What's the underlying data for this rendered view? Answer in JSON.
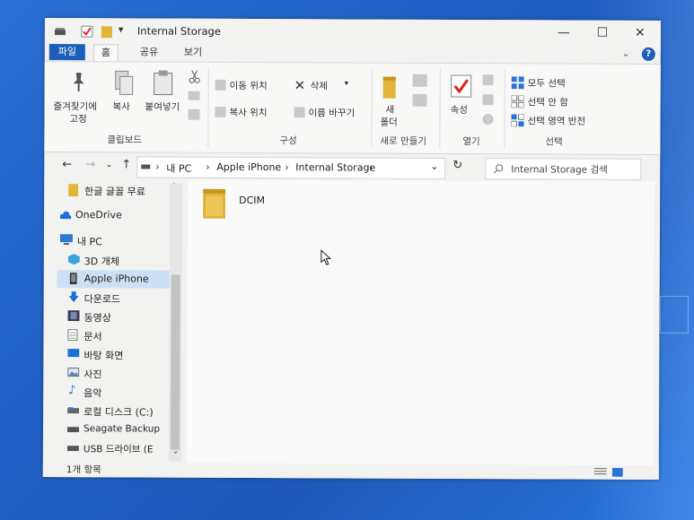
{
  "window": {
    "title": "Internal Storage",
    "minimize_glyph": "—",
    "maximize_glyph": "☐",
    "close_glyph": "✕",
    "dropdown_glyph": "▾"
  },
  "ribbon_tabs": [
    "파일",
    "홈",
    "공유",
    "보기"
  ],
  "ribbon": {
    "clipboard": {
      "pin_label_line1": "즐겨찾기에",
      "pin_label_line2": "고정",
      "copy_label": "복사",
      "paste_label": "붙여넣기",
      "group_label": "클립보드"
    },
    "organize": {
      "move_to": "이동 위치",
      "copy_to": "복사 위치",
      "delete": "삭제",
      "rename": "이름 바꾸기",
      "group_label": "구성"
    },
    "new": {
      "new_folder_line1": "새",
      "new_folder_line2": "폴더",
      "group_label": "새로 만들기"
    },
    "open": {
      "properties": "속성",
      "group_label": "열기"
    },
    "select": {
      "select_all": "모두 선택",
      "select_none": "선택 안 함",
      "invert_selection": "선택 영역 반전",
      "group_label": "선택"
    },
    "help_glyph": "?"
  },
  "address_bar": {
    "segments": [
      "내 PC",
      "Apple iPhone",
      "Internal Storage"
    ],
    "separator": "›",
    "search_placeholder": "Internal Storage 검색"
  },
  "sidebar": {
    "items": [
      {
        "label": "한글 글꼴 무료",
        "icon": "folder-icon"
      },
      {
        "label": "OneDrive",
        "icon": "cloud-icon"
      },
      {
        "label": "내 PC",
        "icon": "pc-icon"
      },
      {
        "label": "3D 개체",
        "icon": "cube-icon"
      },
      {
        "label": "Apple iPhone",
        "icon": "phone-icon"
      },
      {
        "label": "다운로드",
        "icon": "download-icon"
      },
      {
        "label": "동영상",
        "icon": "video-icon"
      },
      {
        "label": "문서",
        "icon": "document-icon"
      },
      {
        "label": "바탕 화면",
        "icon": "desktop-icon"
      },
      {
        "label": "사진",
        "icon": "picture-icon"
      },
      {
        "label": "음악",
        "icon": "music-icon"
      },
      {
        "label": "로컬 디스크 (C:)",
        "icon": "drive-icon"
      },
      {
        "label": "Seagate Backup",
        "icon": "drive-icon"
      },
      {
        "label": "USB 드라이브 (E",
        "icon": "usb-drive-icon"
      }
    ],
    "selected_index": 4
  },
  "content": {
    "items": [
      {
        "name": "DCIM",
        "type": "folder"
      }
    ]
  },
  "status_bar": {
    "item_count": "1개 항목"
  },
  "colors": {
    "file_tab": "#1b5fb8",
    "selection": "#cce0f5",
    "folder": "#e2b43a",
    "desktop": "#2a6fd3"
  }
}
